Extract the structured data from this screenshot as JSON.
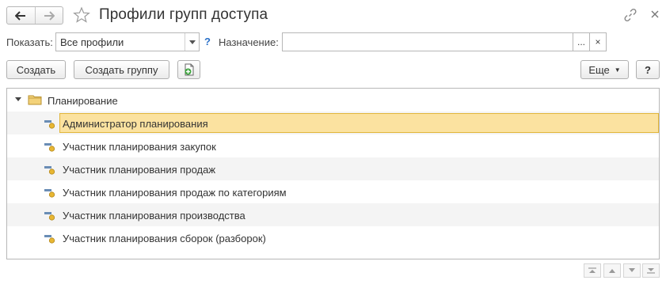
{
  "header": {
    "title": "Профили групп доступа"
  },
  "filter": {
    "show_label": "Показать:",
    "show_value": "Все профили",
    "help_mark": "?",
    "purpose_label": "Назначение:",
    "purpose_value": "",
    "pick_label": "...",
    "clear_label": "×"
  },
  "toolbar": {
    "create_label": "Создать",
    "create_group_label": "Создать группу",
    "more_label": "Еще",
    "help_label": "?"
  },
  "tree": {
    "group_label": "Планирование",
    "items": [
      {
        "label": "Администратор планирования",
        "selected": true
      },
      {
        "label": "Участник планирования закупок"
      },
      {
        "label": "Участник планирования продаж"
      },
      {
        "label": "Участник планирования продаж по категориям"
      },
      {
        "label": "Участник планирования производства"
      },
      {
        "label": "Участник планирования сборок (разборок)"
      }
    ]
  },
  "icons": {
    "back": "arrow-left-icon",
    "forward": "arrow-right-icon",
    "favorite": "star-icon",
    "link": "link-icon",
    "close": "close-icon",
    "folder": "folder-icon",
    "profile": "profile-icon",
    "copy": "copy-add-icon"
  },
  "colors": {
    "selection_fill": "#fbe2a0",
    "selection_border": "#e2b63a",
    "help_blue": "#2a70c8",
    "copy_green": "#3aa33a"
  }
}
